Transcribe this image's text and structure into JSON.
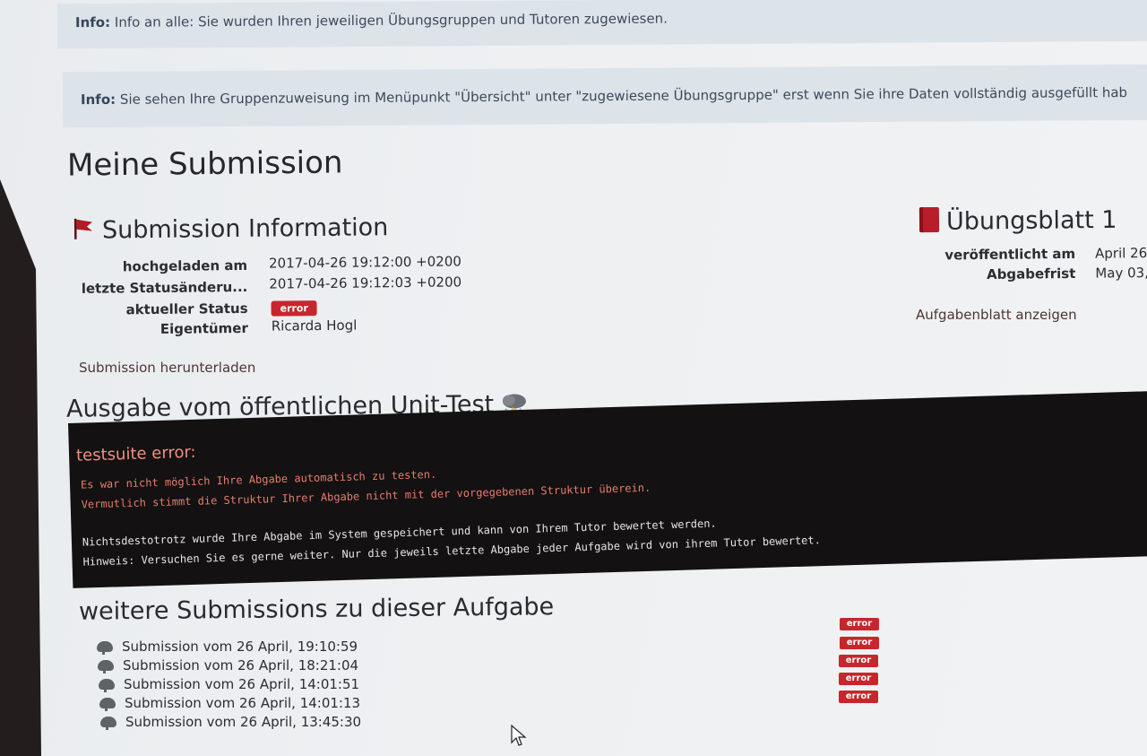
{
  "info": [
    {
      "label": "Info:",
      "text": "Info an alle: Sie wurden Ihren jeweiligen Übungsgruppen und Tutoren zugewiesen."
    },
    {
      "label": "Info:",
      "text": "Sie sehen Ihre Gruppenzuweisung im Menüpunkt \"Übersicht\" unter \"zugewiesene Übungsgruppe\" erst wenn Sie ihre Daten vollständig ausgefüllt hab"
    }
  ],
  "page_title": "Meine Submission",
  "submission_info": {
    "title": "Submission Information",
    "rows": [
      {
        "key": "hochgeladen am",
        "value": "2017-04-26 19:12:00 +0200"
      },
      {
        "key": "letzte Statusänderu...",
        "value": "2017-04-26 19:12:03 +0200"
      },
      {
        "key": "aktueller Status",
        "value": "error"
      },
      {
        "key": "Eigentümer",
        "value": "Ricarda Hogl"
      }
    ],
    "download_link": "Submission herunterladen"
  },
  "sheet": {
    "title": "Übungsblatt 1",
    "rows": [
      {
        "key": "veröffentlicht am",
        "value": "April 26,"
      },
      {
        "key": "Abgabefrist",
        "value": "May 03,"
      }
    ],
    "link": "Aufgabenblatt anzeigen"
  },
  "unit_test": {
    "title": "Ausgabe vom öffentlichen Unit-Test",
    "icon": "storm-cloud-icon",
    "heading": "testsuite error:",
    "lines_red": [
      "Es war nicht möglich Ihre Abgabe automatisch zu testen.",
      "Vermutlich stimmt die Struktur Ihrer Abgabe nicht mit der vorgegebenen Struktur überein."
    ],
    "lines_white": [
      "Nichtsdestotrotz wurde Ihre Abgabe im System gespeichert und kann von Ihrem Tutor bewertet werden.",
      "Hinweis: Versuchen Sie es gerne weiter. Nur die jeweils letzte Abgabe jeder Aufgabe wird von ihrem Tutor bewertet."
    ]
  },
  "other_submissions": {
    "title": "weitere Submissions zu dieser Aufgabe",
    "items": [
      {
        "label": "Submission vom 26 April, 19:10:59",
        "status": "error"
      },
      {
        "label": "Submission vom 26 April, 18:21:04",
        "status": "error"
      },
      {
        "label": "Submission vom 26 April, 14:01:51",
        "status": "error"
      },
      {
        "label": "Submission vom 26 April, 14:01:13",
        "status": "error"
      },
      {
        "label": "Submission vom 26 April, 13:45:30",
        "status": "error"
      }
    ]
  },
  "colors": {
    "error_badge": "#c8262d",
    "info_bg": "#dce4ea",
    "terminal_bg": "#131111"
  }
}
